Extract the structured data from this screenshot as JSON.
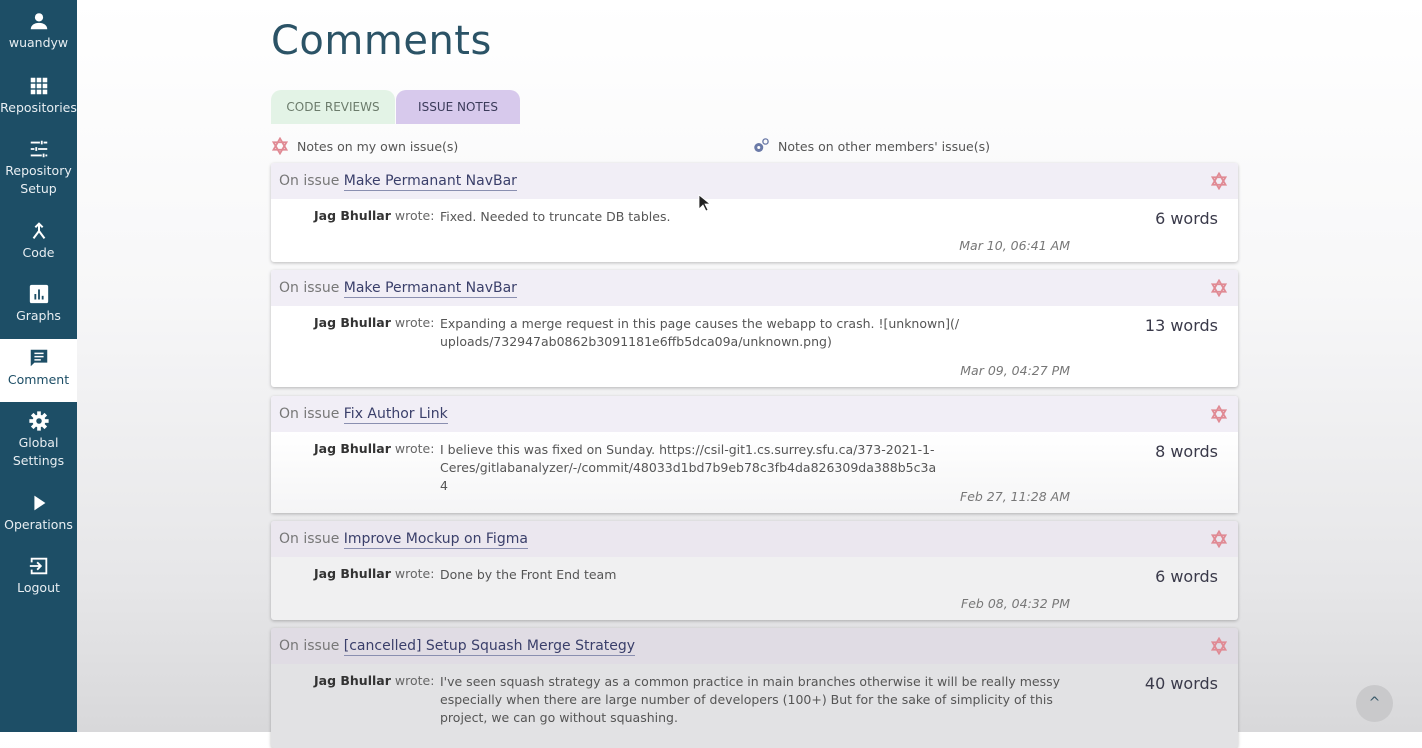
{
  "sidebar": {
    "items": [
      {
        "label": "wuandyw",
        "icon": "user-icon"
      },
      {
        "label": "Repositories",
        "icon": "grid-icon"
      },
      {
        "label": "Repository Setup",
        "icon": "sliders-icon"
      },
      {
        "label": "Code",
        "icon": "merge-icon"
      },
      {
        "label": "Graphs",
        "icon": "bar-chart-icon"
      },
      {
        "label": "Comment",
        "icon": "comment-icon",
        "active": true
      },
      {
        "label": "Global Settings",
        "icon": "gear-icon"
      },
      {
        "label": "Operations",
        "icon": "play-icon"
      },
      {
        "label": "Logout",
        "icon": "logout-icon"
      }
    ]
  },
  "page": {
    "title": "Comments"
  },
  "tabs": [
    {
      "label": "CODE REVIEWS",
      "active": false
    },
    {
      "label": "ISSUE NOTES",
      "active": true
    }
  ],
  "legend": {
    "own": "Notes on my own issue(s)",
    "other": "Notes on other members' issue(s)"
  },
  "colors": {
    "own_issue_icon": "#e08a94",
    "other_issue_icon": "#6b7aa8",
    "sidebar": "#1d4e66"
  },
  "notes": [
    {
      "prefix": "On issue",
      "issue": "Make Permanant NavBar",
      "author": "Jag Bhullar",
      "wrote": "wrote:",
      "text": "Fixed. Needed to truncate DB tables.",
      "words": "6 words",
      "date": "Mar 10, 06:41 AM"
    },
    {
      "prefix": "On issue",
      "issue": "Make Permanant NavBar",
      "author": "Jag Bhullar",
      "wrote": "wrote:",
      "text": "Expanding a merge request in this page causes the webapp to crash. ![unknown](/uploads/732947ab0862b3091181e6ffb5dca09a/unknown.png)",
      "words": "13 words",
      "date": "Mar 09, 04:27 PM"
    },
    {
      "prefix": "On issue",
      "issue": "Fix Author Link",
      "author": "Jag Bhullar",
      "wrote": "wrote:",
      "text": "I believe this was fixed on Sunday. https://csil-git1.cs.surrey.sfu.ca/373-2021-1-Ceres/gitlabanalyzer/-/commit/48033d1bd7b9eb78c3fb4da826309da388b5c3a4",
      "words": "8 words",
      "date": "Feb 27, 11:28 AM"
    },
    {
      "prefix": "On issue",
      "issue": "Improve Mockup on Figma",
      "author": "Jag Bhullar",
      "wrote": "wrote:",
      "text": "Done by the Front End team",
      "words": "6 words",
      "date": "Feb 08, 04:32 PM"
    },
    {
      "prefix": "On issue",
      "issue": "[cancelled] Setup Squash Merge Strategy",
      "author": "Jag Bhullar",
      "wrote": "wrote:",
      "text": "I've seen squash strategy as a common practice in main branches otherwise it will be really messy especially when there are large number of developers (100+) But for the sake of simplicity of this project, we can go without squashing.",
      "words": "40 words",
      "date": ""
    }
  ],
  "scroll_top": {
    "icon": "chevron-up-icon",
    "glyph": "^"
  }
}
